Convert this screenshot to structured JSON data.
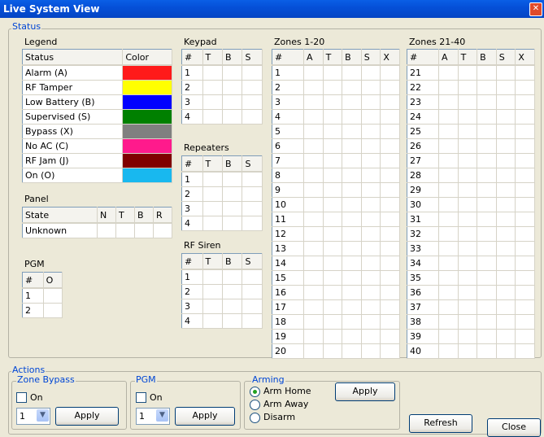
{
  "window": {
    "title": "Live System View",
    "close_glyph": "✕"
  },
  "status_group": {
    "title": "Status"
  },
  "legend": {
    "title": "Legend",
    "headers": [
      "Status",
      "Color"
    ],
    "rows": [
      {
        "label": "Alarm (A)",
        "color": "#ff1a1a"
      },
      {
        "label": "RF Tamper",
        "color": "#ffff00"
      },
      {
        "label": "Low Battery (B)",
        "color": "#0000ff"
      },
      {
        "label": "Supervised (S)",
        "color": "#008000"
      },
      {
        "label": "Bypass (X)",
        "color": "#808080"
      },
      {
        "label": "No AC (C)",
        "color": "#ff1a8c"
      },
      {
        "label": "RF Jam (J)",
        "color": "#800000"
      },
      {
        "label": "On (O)",
        "color": "#18b8ef"
      }
    ]
  },
  "panel": {
    "title": "Panel",
    "headers": [
      "State",
      "N",
      "T",
      "B",
      "R"
    ],
    "rows": [
      [
        "Unknown",
        "",
        "",
        "",
        ""
      ]
    ]
  },
  "pgm_status": {
    "title": "PGM",
    "headers": [
      "#",
      "O"
    ],
    "rows": [
      [
        "1",
        ""
      ],
      [
        "2",
        ""
      ]
    ]
  },
  "keypad": {
    "title": "Keypad",
    "headers": [
      "#",
      "T",
      "B",
      "S"
    ],
    "rows": [
      [
        "1",
        "",
        "",
        ""
      ],
      [
        "2",
        "",
        "",
        ""
      ],
      [
        "3",
        "",
        "",
        ""
      ],
      [
        "4",
        "",
        "",
        ""
      ]
    ]
  },
  "repeaters": {
    "title": "Repeaters",
    "headers": [
      "#",
      "T",
      "B",
      "S"
    ],
    "rows": [
      [
        "1",
        "",
        "",
        ""
      ],
      [
        "2",
        "",
        "",
        ""
      ],
      [
        "3",
        "",
        "",
        ""
      ],
      [
        "4",
        "",
        "",
        ""
      ]
    ]
  },
  "rf_siren": {
    "title": "RF Siren",
    "headers": [
      "#",
      "T",
      "B",
      "S"
    ],
    "rows": [
      [
        "1",
        "",
        "",
        ""
      ],
      [
        "2",
        "",
        "",
        ""
      ],
      [
        "3",
        "",
        "",
        ""
      ],
      [
        "4",
        "",
        "",
        ""
      ]
    ]
  },
  "zones_1_20": {
    "title": "Zones 1-20",
    "headers": [
      "#",
      "A",
      "T",
      "B",
      "S",
      "X"
    ],
    "rows": [
      [
        "1"
      ],
      [
        "2"
      ],
      [
        "3"
      ],
      [
        "4"
      ],
      [
        "5"
      ],
      [
        "6"
      ],
      [
        "7"
      ],
      [
        "8"
      ],
      [
        "9"
      ],
      [
        "10"
      ],
      [
        "11"
      ],
      [
        "12"
      ],
      [
        "13"
      ],
      [
        "14"
      ],
      [
        "15"
      ],
      [
        "16"
      ],
      [
        "17"
      ],
      [
        "18"
      ],
      [
        "19"
      ],
      [
        "20"
      ]
    ]
  },
  "zones_21_40": {
    "title": "Zones 21-40",
    "headers": [
      "#",
      "A",
      "T",
      "B",
      "S",
      "X"
    ],
    "rows": [
      [
        "21"
      ],
      [
        "22"
      ],
      [
        "23"
      ],
      [
        "24"
      ],
      [
        "25"
      ],
      [
        "26"
      ],
      [
        "27"
      ],
      [
        "28"
      ],
      [
        "29"
      ],
      [
        "30"
      ],
      [
        "31"
      ],
      [
        "32"
      ],
      [
        "33"
      ],
      [
        "34"
      ],
      [
        "35"
      ],
      [
        "36"
      ],
      [
        "37"
      ],
      [
        "38"
      ],
      [
        "39"
      ],
      [
        "40"
      ]
    ]
  },
  "actions": {
    "title": "Actions",
    "zone_bypass": {
      "title": "Zone Bypass",
      "checkbox_label": "On",
      "checked": false,
      "select_value": "1",
      "apply_label": "Apply"
    },
    "pgm": {
      "title": "PGM",
      "checkbox_label": "On",
      "checked": false,
      "select_value": "1",
      "apply_label": "Apply"
    },
    "arming": {
      "title": "Arming",
      "options": [
        "Arm Home",
        "Arm Away",
        "Disarm"
      ],
      "selected": "Arm Home",
      "apply_label": "Apply"
    },
    "refresh_label": "Refresh",
    "close_label": "Close"
  }
}
